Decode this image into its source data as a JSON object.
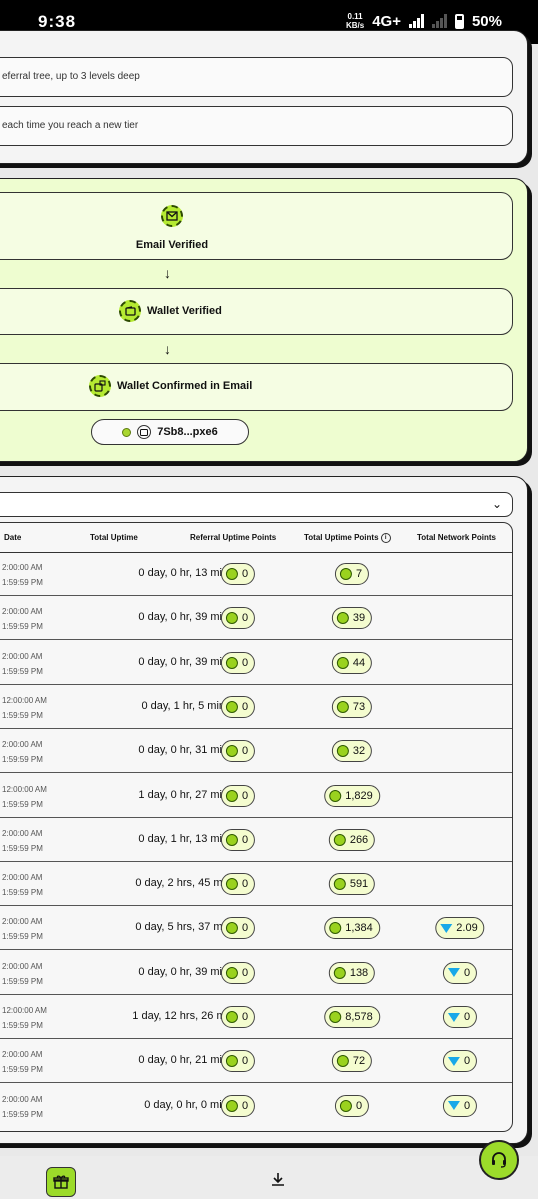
{
  "status_bar": {
    "time": "9:38",
    "speed_value": "0.11",
    "speed_unit": "KB/s",
    "network": "4G+",
    "battery": "50%"
  },
  "info": {
    "items": [
      "eferral tree, up to 3 levels deep",
      "each time you reach a new tier"
    ]
  },
  "verification": {
    "steps": [
      "Email Verified",
      "Wallet Verified",
      "Wallet Confirmed in Email"
    ],
    "wallet_address": "7Sb8...pxe6"
  },
  "table": {
    "headers": {
      "date": "Date",
      "total_uptime": "Total Uptime",
      "referral_points": "Referral Uptime Points",
      "uptime_points": "Total Uptime Points",
      "network_points": "Total Network Points"
    },
    "rows": [
      {
        "date_start": "2:00:00 AM",
        "date_end": "1:59:59 PM",
        "uptime": "0 day, 0 hr, 13 mins",
        "referral": "0",
        "uptime_points": "7",
        "network": ""
      },
      {
        "date_start": "2:00:00 AM",
        "date_end": "1:59:59 PM",
        "uptime": "0 day, 0 hr, 39 mins",
        "referral": "0",
        "uptime_points": "39",
        "network": ""
      },
      {
        "date_start": "2:00:00 AM",
        "date_end": "1:59:59 PM",
        "uptime": "0 day, 0 hr, 39 mins",
        "referral": "0",
        "uptime_points": "44",
        "network": ""
      },
      {
        "date_start": "12:00:00 AM",
        "date_end": "1:59:59 PM",
        "uptime": "0 day, 1 hr, 5 mins",
        "referral": "0",
        "uptime_points": "73",
        "network": ""
      },
      {
        "date_start": "2:00:00 AM",
        "date_end": "1:59:59 PM",
        "uptime": "0 day, 0 hr, 31 mins",
        "referral": "0",
        "uptime_points": "32",
        "network": ""
      },
      {
        "date_start": "12:00:00 AM",
        "date_end": "1:59:59 PM",
        "uptime": "1 day, 0 hr, 27 mins",
        "referral": "0",
        "uptime_points": "1,829",
        "network": ""
      },
      {
        "date_start": "2:00:00 AM",
        "date_end": "1:59:59 PM",
        "uptime": "0 day, 1 hr, 13 mins",
        "referral": "0",
        "uptime_points": "266",
        "network": ""
      },
      {
        "date_start": "2:00:00 AM",
        "date_end": "1:59:59 PM",
        "uptime": "0 day, 2 hrs, 45 mins",
        "referral": "0",
        "uptime_points": "591",
        "network": ""
      },
      {
        "date_start": "2:00:00 AM",
        "date_end": "1:59:59 PM",
        "uptime": "0 day, 5 hrs, 37 mins",
        "referral": "0",
        "uptime_points": "1,384",
        "network": "2.09"
      },
      {
        "date_start": "2:00:00 AM",
        "date_end": "1:59:59 PM",
        "uptime": "0 day, 0 hr, 39 mins",
        "referral": "0",
        "uptime_points": "138",
        "network": "0"
      },
      {
        "date_start": "12:00:00 AM",
        "date_end": "1:59:59 PM",
        "uptime": "1 day, 12 hrs, 26 mins",
        "referral": "0",
        "uptime_points": "8,578",
        "network": "0"
      },
      {
        "date_start": "2:00:00 AM",
        "date_end": "1:59:59 PM",
        "uptime": "0 day, 0 hr, 21 mins",
        "referral": "0",
        "uptime_points": "72",
        "network": "0"
      },
      {
        "date_start": "2:00:00 AM",
        "date_end": "1:59:59 PM",
        "uptime": "0 day, 0 hr, 0 min",
        "referral": "0",
        "uptime_points": "0",
        "network": "0"
      }
    ]
  },
  "colors": {
    "accent": "#9cdb2a",
    "panel_green": "#eefdd0",
    "gem": "#18a8e8"
  },
  "icons": [
    "envelope-icon",
    "wallet-icon",
    "wallet-check-icon",
    "coin-icon",
    "gem-icon",
    "info-icon",
    "chevron-down-icon",
    "gift-icon",
    "download-icon",
    "headset-icon"
  ]
}
